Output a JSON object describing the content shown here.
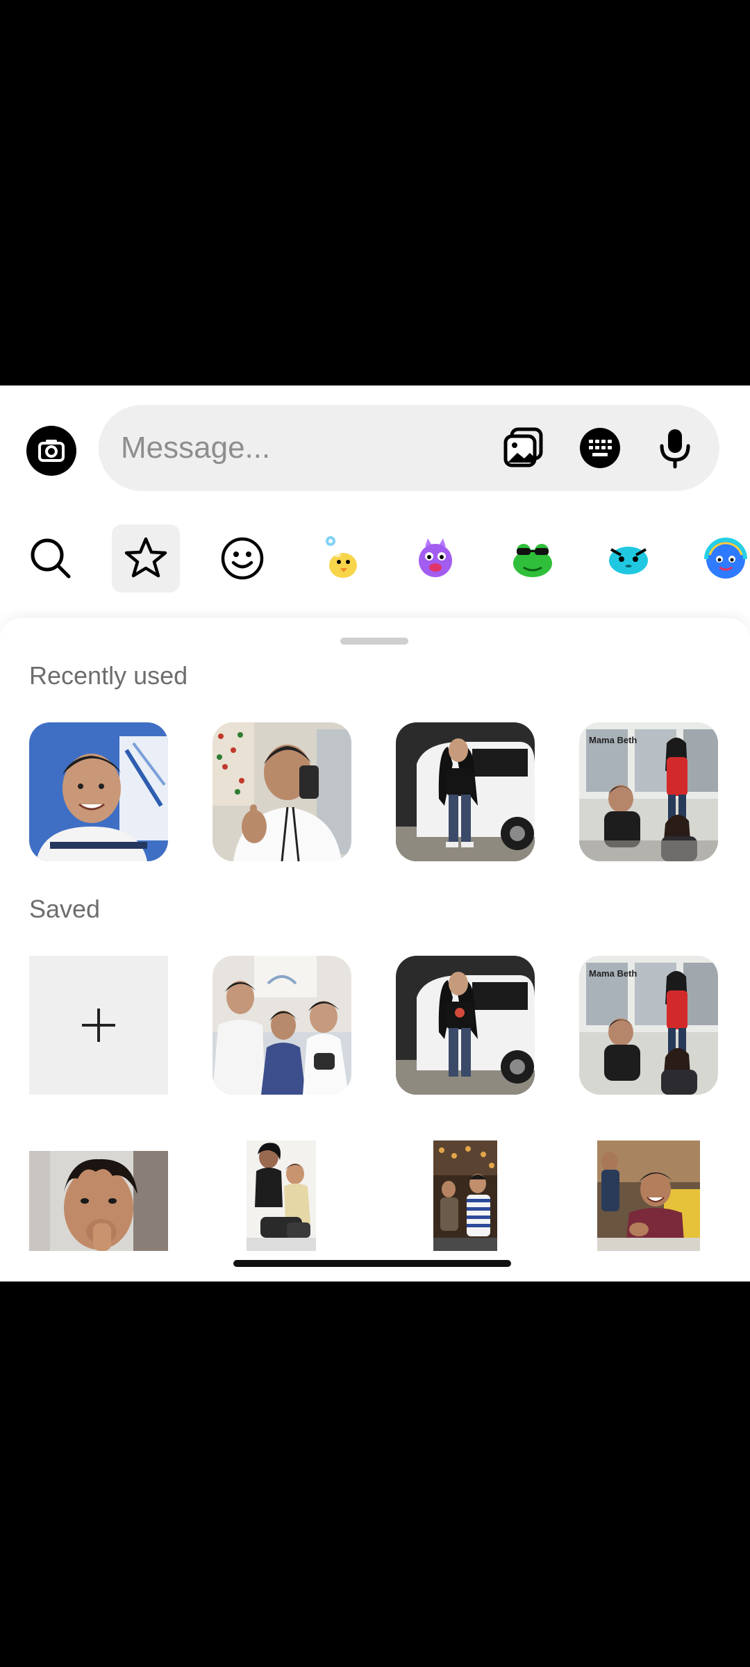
{
  "composer": {
    "placeholder": "Message...",
    "camera_icon": "camera-icon",
    "gallery_icon": "gallery-icon",
    "keyboard_icon": "keyboard-icon",
    "mic_icon": "microphone-icon"
  },
  "tabs": [
    {
      "icon": "search-icon",
      "active": false
    },
    {
      "icon": "star-icon",
      "active": true
    },
    {
      "icon": "smiley-icon",
      "active": false
    },
    {
      "icon": "yellow-chick-sticker",
      "active": false
    },
    {
      "icon": "purple-monster-sticker",
      "active": false
    },
    {
      "icon": "green-frog-sticker",
      "active": false
    },
    {
      "icon": "blue-blob-sticker",
      "active": false
    },
    {
      "icon": "rainbow-blob-sticker",
      "active": false
    }
  ],
  "sections": {
    "recent": "Recently used",
    "saved": "Saved"
  },
  "recent_items": [
    {
      "icon": "selfie-gif"
    },
    {
      "icon": "thumbs-up-gif"
    },
    {
      "icon": "dancing-girl-gif"
    },
    {
      "icon": "group-gif",
      "caption": "Mama Beth"
    }
  ],
  "saved_items": [
    {
      "icon": "add-icon"
    },
    {
      "icon": "friends-gif"
    },
    {
      "icon": "dancing-girl-gif"
    },
    {
      "icon": "group-gif",
      "caption": "Mama Beth"
    },
    {
      "icon": "closeup-face-gif"
    },
    {
      "icon": "crouching-people-gif"
    },
    {
      "icon": "striped-shirt-gif"
    },
    {
      "icon": "laughing-gif"
    }
  ]
}
